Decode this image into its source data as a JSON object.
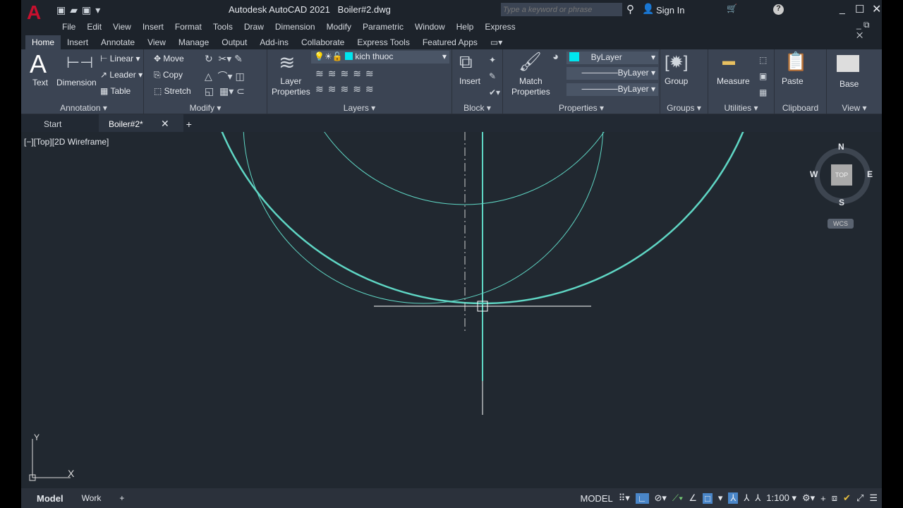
{
  "title": {
    "app": "Autodesk AutoCAD 2021",
    "file": "Boiler#2.dwg",
    "search_placeholder": "Type a keyword or phrase",
    "sign_in": "Sign In"
  },
  "menu": [
    "File",
    "Edit",
    "View",
    "Insert",
    "Format",
    "Tools",
    "Draw",
    "Dimension",
    "Modify",
    "Parametric",
    "Window",
    "Help",
    "Express"
  ],
  "ribbon_tabs": [
    "Home",
    "Insert",
    "Annotate",
    "View",
    "Manage",
    "Output",
    "Add-ins",
    "Collaborate",
    "Express Tools",
    "Featured Apps"
  ],
  "annotation": {
    "text": "Text",
    "dimension": "Dimension",
    "linear": "Linear",
    "leader": "Leader",
    "table": "Table",
    "label": "Annotation"
  },
  "modify": {
    "move": "Move",
    "copy": "Copy",
    "stretch": "Stretch",
    "label": "Modify"
  },
  "layers": {
    "layer_properties": "Layer Properties",
    "current_layer": "kich thuoc",
    "label": "Layers",
    "layer_color": "#00e5ee"
  },
  "block": {
    "insert": "Insert",
    "label": "Block"
  },
  "properties": {
    "match": "Match Properties",
    "color": "ByLayer",
    "linetype": "ByLayer",
    "lineweight": "ByLayer",
    "label": "Properties"
  },
  "groups": {
    "group": "Group",
    "label": "Groups"
  },
  "utilities": {
    "measure": "Measure",
    "label": "Utilities"
  },
  "clipboard": {
    "paste": "Paste",
    "label": "Clipboard"
  },
  "view": {
    "base": "Base",
    "label": "View"
  },
  "doc_tabs": {
    "start": "Start",
    "active": "Boiler#2*"
  },
  "viewport": {
    "label": "[−][Top][2D Wireframe]",
    "cube_top": "TOP",
    "n": "N",
    "s": "S",
    "e": "E",
    "w": "W",
    "wcs": "WCS",
    "ucs_x": "X",
    "ucs_y": "Y"
  },
  "layout_tabs": [
    "Model",
    "Work"
  ],
  "status": {
    "model": "MODEL",
    "scale": "1:100"
  },
  "colors": {
    "geometry": "#5fd6c4",
    "background": "#212830"
  }
}
